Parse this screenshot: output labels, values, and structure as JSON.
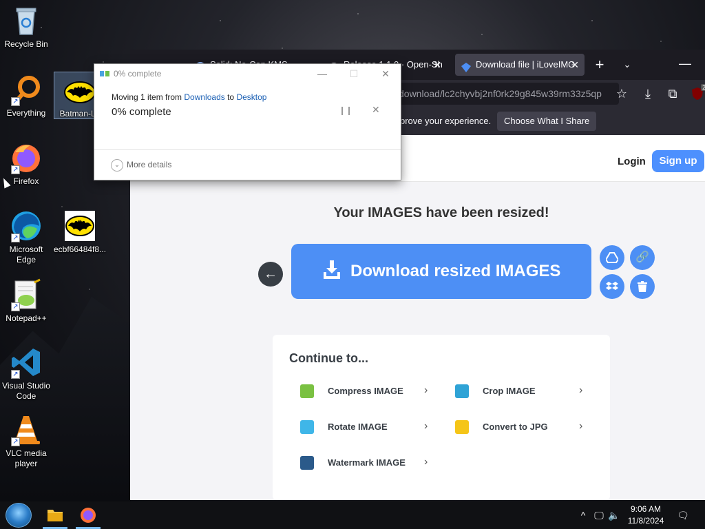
{
  "desktop": {
    "icons": [
      {
        "label": "Recycle Bin"
      },
      {
        "label": "Everything"
      },
      {
        "label": "Batman-Lo"
      },
      {
        "label": "Firefox"
      },
      {
        "label": "Microsoft Edge"
      },
      {
        "label": "ecbf66484f8..."
      },
      {
        "label": "Notepad++"
      },
      {
        "label": "Visual Studio Code"
      },
      {
        "label": "VLC media player"
      }
    ]
  },
  "browser": {
    "tabs": [
      {
        "label": "Solid: No-Cap KMS",
        "icon": "firefox-tab-icon"
      },
      {
        "label": "Release 1.1.0 · Open-Sh",
        "icon": "github-icon"
      },
      {
        "label": "Download file | iLoveIMG",
        "icon": "iloveimg-icon",
        "active": true
      }
    ],
    "url": "download/lc2chyvbj2nf0rk29g845w39rm33z5qp",
    "notification": {
      "text": "prove your experience.",
      "button": "Choose What I Share"
    },
    "extension_badge": "2"
  },
  "site": {
    "login": "Login",
    "signup": "Sign up",
    "heading": "Your IMAGES have been resized!",
    "download_button": "Download resized IMAGES",
    "continue_title": "Continue to...",
    "tools": [
      {
        "label": "Compress IMAGE",
        "color": "#7ac142"
      },
      {
        "label": "Crop IMAGE",
        "color": "#2fa3d6"
      },
      {
        "label": "Rotate IMAGE",
        "color": "#3fb6e8"
      },
      {
        "label": "Convert to JPG",
        "color": "#f5c518"
      },
      {
        "label": "Watermark IMAGE",
        "color": "#2b5a8a"
      }
    ]
  },
  "dialog": {
    "title": "0% complete",
    "moving_prefix": "Moving 1 item from ",
    "from": "Downloads",
    "to_word": " to ",
    "to": "Desktop",
    "percent": "0% complete",
    "more_details": "More details"
  },
  "taskbar": {
    "time": "9:06 AM",
    "date": "11/8/2024"
  },
  "colors": {
    "accent": "#4d8ff5",
    "browser_dark": "#1c1b22",
    "browser_toolbar": "#2b2a33"
  }
}
